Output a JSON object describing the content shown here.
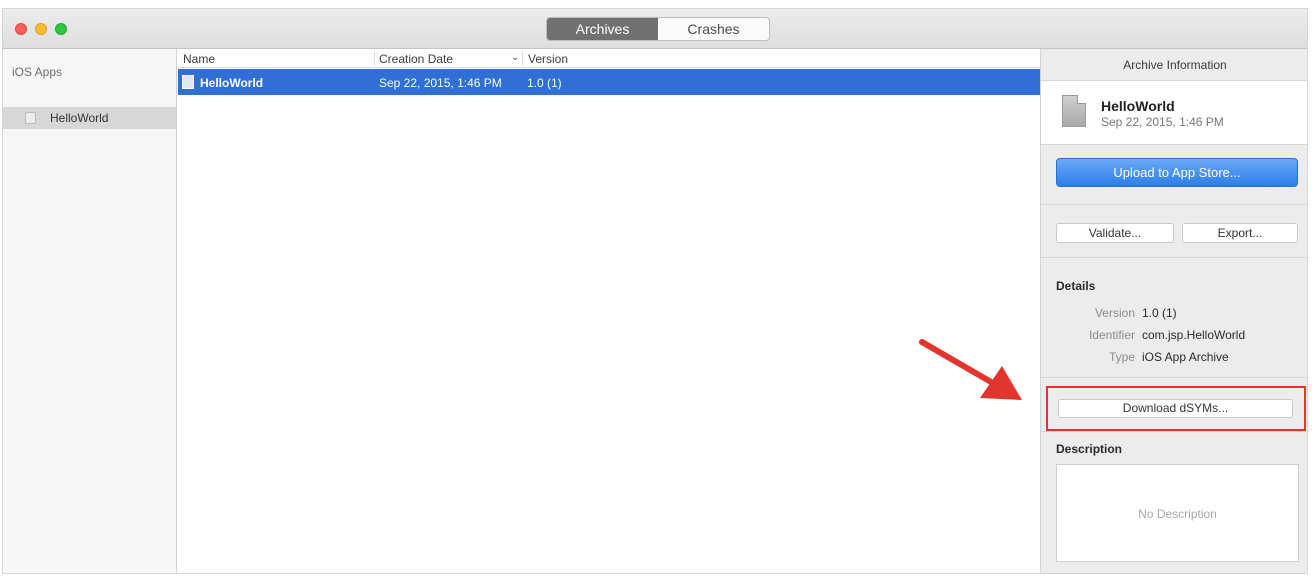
{
  "toolbar": {
    "tabs": [
      {
        "label": "Archives",
        "active": true
      },
      {
        "label": "Crashes",
        "active": false
      }
    ]
  },
  "sidebar": {
    "header": "iOS Apps",
    "items": [
      {
        "label": "HelloWorld",
        "icon": "app-icon",
        "selected": true
      }
    ]
  },
  "table": {
    "columns": [
      "Name",
      "Creation Date",
      "Version"
    ],
    "rows": [
      {
        "name": "HelloWorld",
        "date": "Sep 22, 2015, 1:46 PM",
        "version": "1.0 (1)",
        "icon": "archive-file-icon",
        "selected": true
      }
    ]
  },
  "inspector": {
    "title": "Archive Information",
    "archive": {
      "name": "HelloWorld",
      "date": "Sep 22, 2015, 1:46 PM"
    },
    "upload_label": "Upload to App Store...",
    "validate_label": "Validate...",
    "export_label": "Export...",
    "details": {
      "title": "Details",
      "fields": [
        {
          "key": "Version",
          "value": "1.0 (1)"
        },
        {
          "key": "Identifier",
          "value": "com.jsp.HelloWorld"
        },
        {
          "key": "Type",
          "value": "iOS App Archive"
        }
      ]
    },
    "dsym_label": "Download dSYMs...",
    "description": {
      "title": "Description",
      "placeholder": "No Description"
    }
  },
  "colors": {
    "selection": "#2f6fd6",
    "upload_button": "#2d7ee9",
    "highlight": "#e1352d",
    "close": "#fc5f57",
    "minimize": "#fdbb2e",
    "maximize": "#2ac841"
  }
}
